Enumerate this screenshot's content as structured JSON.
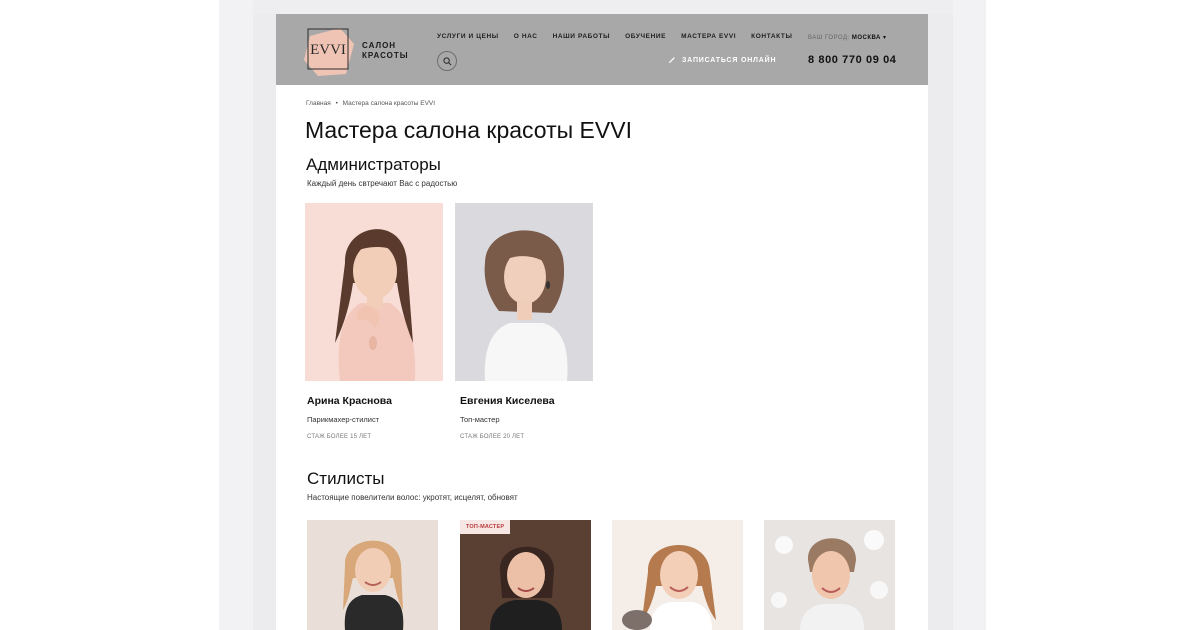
{
  "header": {
    "logo_text": "EVVI",
    "logo_subtitle_line1": "САЛОН",
    "logo_subtitle_line2": "КРАСОТЫ",
    "nav": [
      "УСЛУГИ И ЦЕНЫ",
      "О НАС",
      "НАШИ РАБОТЫ",
      "ОБУЧЕНИЕ",
      "МАСТЕРА EVVI",
      "КОНТАКТЫ"
    ],
    "city_label": "ВАШ ГОРОД:",
    "city_value": "МОСКВА ▾",
    "book_label": "ЗАПИСАТЬСЯ ОНЛАЙН",
    "phone": "8 800 770 09 04"
  },
  "breadcrumb": {
    "home": "Главная",
    "separator": "•",
    "current": "Мастера салона красоты EVVI"
  },
  "page_title": "Мастера салона красоты EVVI",
  "admins": {
    "title": "Администраторы",
    "subtitle": "Каждый день свтречают Вас с радостью",
    "people": [
      {
        "name": "Арина Краснова",
        "role": "Парикмахер-стилист",
        "experience": "СТАЖ БОЛЕЕ 15 ЛЕТ"
      },
      {
        "name": "Евгения Киселева",
        "role": "Топ-мастер",
        "experience": "СТАЖ БОЛЕЕ 20 ЛЕТ"
      }
    ]
  },
  "stylists": {
    "title": "Стилисты",
    "subtitle": "Настоящие повелители волос: укротят, исцелят, обновят",
    "badge": "ТОП-МАСТЕР"
  },
  "colors": {
    "header_bg": "#a8a8a8",
    "logo_pink": "#f0c4b4",
    "badge_text": "#b93a3a"
  }
}
